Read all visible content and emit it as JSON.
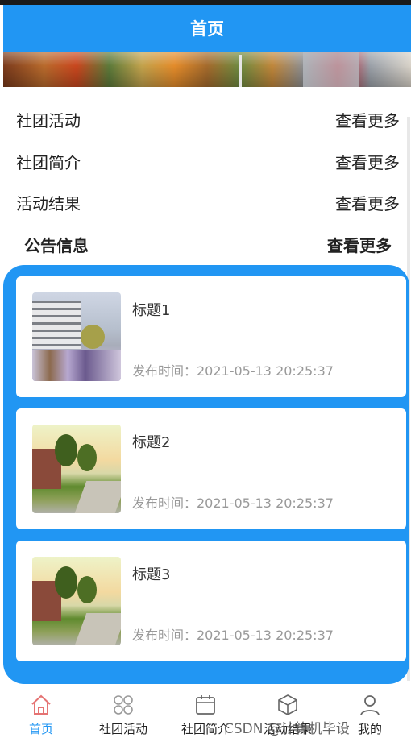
{
  "header": {
    "title": "首页"
  },
  "sections": [
    {
      "label": "社团活动",
      "more": "查看更多"
    },
    {
      "label": "社团简介",
      "more": "查看更多"
    },
    {
      "label": "活动结果",
      "more": "查看更多"
    }
  ],
  "notice": {
    "label": "公告信息",
    "more": "查看更多"
  },
  "cards": [
    {
      "title": "标题1",
      "time": "发布时间：2021-05-13 20:25:37"
    },
    {
      "title": "标题2",
      "time": "发布时间：2021-05-13 20:25:37"
    },
    {
      "title": "标题3",
      "time": "发布时间：2021-05-13 20:25:37"
    }
  ],
  "tabbar": {
    "items": [
      {
        "label": "首页",
        "icon": "home-icon",
        "active": true
      },
      {
        "label": "社团活动",
        "icon": "grid-icon",
        "active": false
      },
      {
        "label": "社团简介",
        "icon": "calendar-icon",
        "active": false
      },
      {
        "label": "活动结果",
        "icon": "box-icon",
        "active": false
      },
      {
        "label": "我的",
        "icon": "user-icon",
        "active": false
      }
    ]
  },
  "watermark": "CSDN @计算机毕设",
  "colors": {
    "primary": "#2196f3",
    "active_tab": "#2196f3",
    "home_icon": "#e57373"
  }
}
